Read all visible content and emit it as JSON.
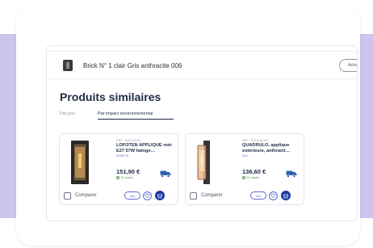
{
  "header": {
    "product_name": "Brick N° 1 clair Gris anthracite 006",
    "buy_button": "Achat"
  },
  "section": {
    "title": "Produits similaires",
    "tabs": [
      "Par prix",
      "Par impact environnemental"
    ]
  },
  "products": [
    {
      "ref": "REF : NOI12403V",
      "name": "LOFOTEN APPLIQUE noir E27 57W haloge…",
      "brand": "NORLYS",
      "price": "151,90 €",
      "stock": "En stock",
      "compare": "Comparer",
      "view": "Voir"
    },
    {
      "ref": "REF : SCI1U62403",
      "name": "QUADRULO, applique extérieure, anthracit…",
      "brand": "SLV",
      "price": "136,60 €",
      "stock": "En stock",
      "compare": "Comparer",
      "view": "Voir"
    }
  ],
  "colors": {
    "band": "#cdc4ee",
    "accent": "#1b3aa3",
    "link": "#5c6bd6",
    "title": "#1f2a44"
  }
}
